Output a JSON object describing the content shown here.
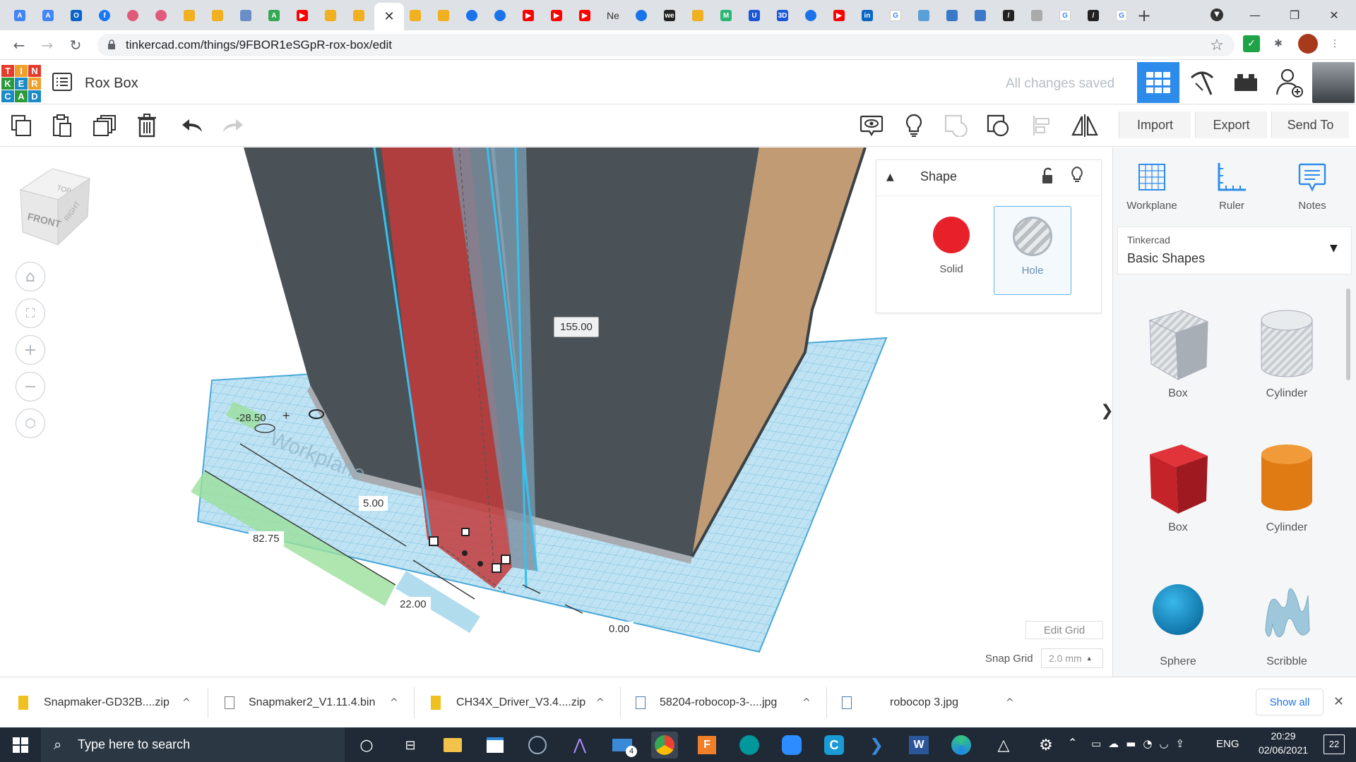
{
  "browser": {
    "url": "tinkercad.com/things/9FBOR1eSGpR-rox-box/edit",
    "tab_labels": [
      "Ne"
    ]
  },
  "header": {
    "logo_letters": [
      "T",
      "I",
      "N",
      "K",
      "E",
      "R",
      "C",
      "A",
      "D"
    ],
    "design_title": "Rox Box",
    "save_status": "All changes saved"
  },
  "toolbar": {
    "import_label": "Import",
    "export_label": "Export",
    "send_to_label": "Send To"
  },
  "viewcube": {
    "top": "TOP",
    "front": "FRONT",
    "right": "RIGHT"
  },
  "dimensions": {
    "height": "155.00",
    "x_offset": "-28.50",
    "depth_small": "5.00",
    "length": "82.75",
    "width": "22.00",
    "elevation": "0.00"
  },
  "shape_panel": {
    "title": "Shape",
    "solid_label": "Solid",
    "hole_label": "Hole",
    "solid_color": "#e8202a"
  },
  "workspace": {
    "edit_grid_label": "Edit Grid",
    "snap_grid_label": "Snap Grid",
    "snap_grid_value": "2.0 mm"
  },
  "sidebar": {
    "tools": [
      {
        "label": "Workplane",
        "icon": "workplane-icon"
      },
      {
        "label": "Ruler",
        "icon": "ruler-icon"
      },
      {
        "label": "Notes",
        "icon": "notes-icon"
      }
    ],
    "library_caption": "Tinkercad",
    "library_value": "Basic Shapes",
    "shapes": [
      {
        "label": "Box",
        "icon": "box-hole-icon"
      },
      {
        "label": "Cylinder",
        "icon": "cylinder-hole-icon"
      },
      {
        "label": "Box",
        "icon": "box-solid-icon"
      },
      {
        "label": "Cylinder",
        "icon": "cylinder-solid-icon"
      },
      {
        "label": "Sphere",
        "icon": "sphere-icon"
      },
      {
        "label": "Scribble",
        "icon": "scribble-icon"
      }
    ]
  },
  "downloads": {
    "items": [
      "Snapmaker-GD32B....zip",
      "Snapmaker2_V1.11.4.bin",
      "CH34X_Driver_V3.4....zip",
      "58204-robocop-3-....jpg",
      "robocop 3.jpg"
    ],
    "show_all_label": "Show all"
  },
  "taskbar": {
    "search_placeholder": "Type here to search",
    "mail_badge": "4",
    "language": "ENG",
    "time": "20:29",
    "date": "02/06/2021",
    "notification_count": "22"
  }
}
